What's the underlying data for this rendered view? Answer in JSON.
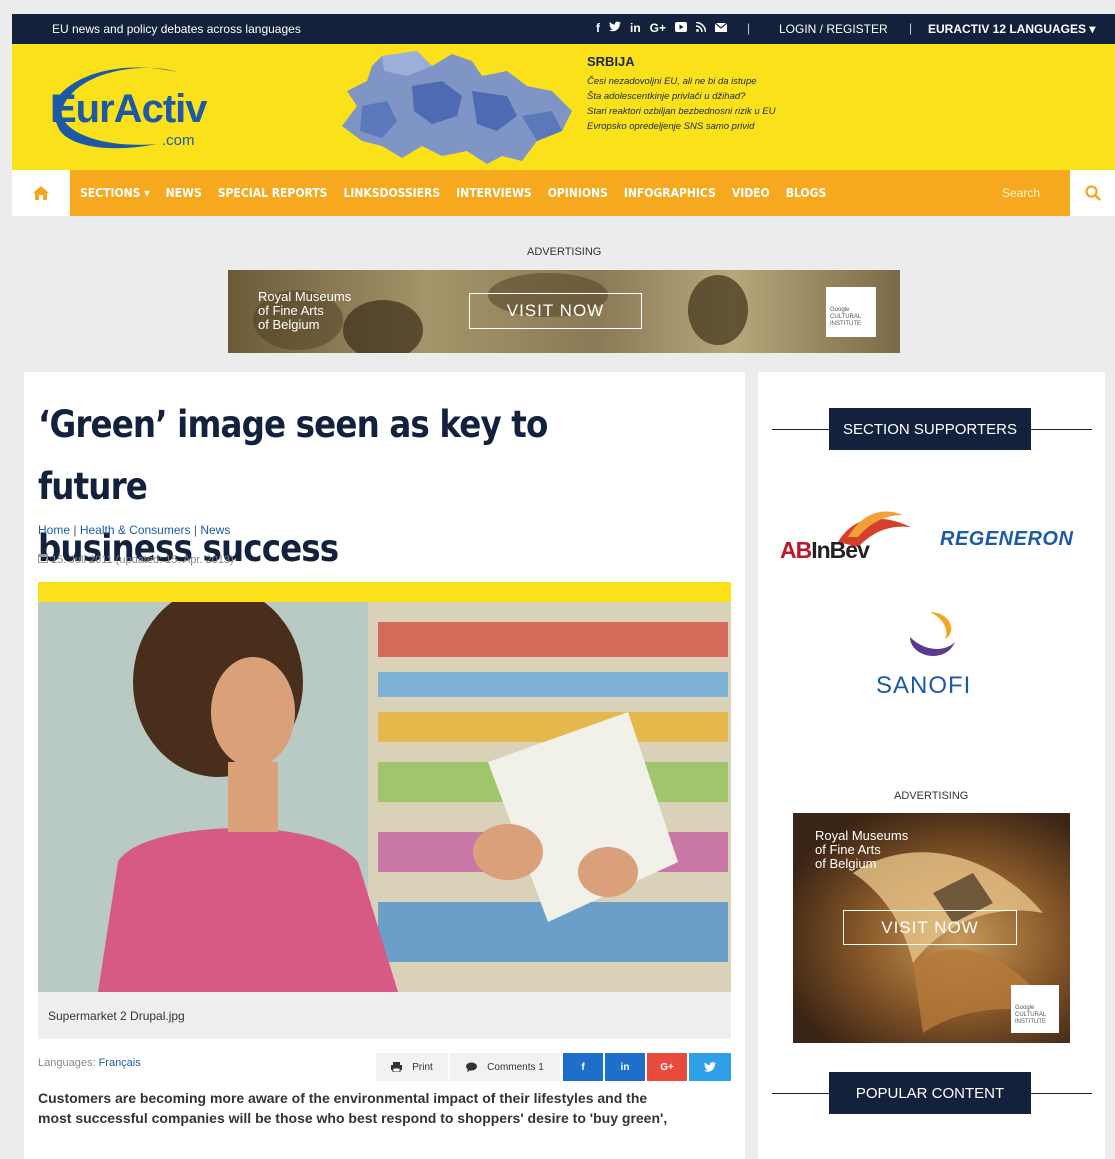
{
  "topbar": {
    "tagline": "EU news and policy debates across languages",
    "social_icons": [
      "facebook-icon",
      "twitter-icon",
      "linkedin-icon",
      "google-plus-icon",
      "youtube-icon",
      "rss-icon",
      "mail-icon"
    ],
    "login": "LOGIN / REGISTER",
    "languages": "EURACTIV 12 LANGUAGES"
  },
  "header": {
    "logo_text": "EurActiv",
    "logo_com": ".com",
    "edition": {
      "title": "SRBIJA",
      "items": [
        "Česi nezadovoljni EU, ali ne bi da istupe",
        "Šta adolescentkinje privlači u džihad?",
        "Stari reaktori ozbiljan bezbednosni rizik u EU",
        "Evropsko opredeljenje SNS samo privid"
      ]
    }
  },
  "nav": {
    "items": [
      "SECTIONS",
      "NEWS",
      "SPECIAL REPORTS",
      "LINKSDOSSIERS",
      "INTERVIEWS",
      "OPINIONS",
      "INFOGRAPHICS",
      "VIDEO",
      "BLOGS"
    ],
    "search_placeholder": "Search"
  },
  "top_ad": {
    "label": "ADVERTISING",
    "museum_line1": "Royal Museums",
    "museum_line2": "of Fine Arts",
    "museum_line3": "of Belgium",
    "cta": "VISIT NOW",
    "partner1": "Google",
    "partner2": "CULTURAL",
    "partner3": "INSTITUTE"
  },
  "article": {
    "title_line1": "‘Green’ image seen as key to future",
    "title_line2": "business success",
    "crumb_home": "Home",
    "crumb_section": "Health & Consumers",
    "crumb_type": "News",
    "date": "15. Juli 2011 (updated: 15. Apr. 2013)",
    "caption": "Supermarket 2 Drupal.jpg",
    "languages_label": "Languages:",
    "languages_value": "Français",
    "print": "Print",
    "comments": "Comments 1",
    "share_fb": "f",
    "share_li": "in",
    "share_gp": "G+",
    "lead_line1": "Customers are becoming more aware of the environmental impact of their lifestyles and the",
    "lead_line2": "most successful companies will be those who best respond to shoppers' desire to 'buy green',"
  },
  "sidebar": {
    "supporters_title": "SECTION SUPPORTERS",
    "sponsor_ab": "AB",
    "sponsor_inbev": "InBev",
    "sponsor_regeneron": "REGENERON",
    "sponsor_sanofi": "SANOFI",
    "ad_label": "ADVERTISING",
    "ad_museum_line1": "Royal Museums",
    "ad_museum_line2": "of Fine Arts",
    "ad_museum_line3": "of Belgium",
    "ad_cta": "VISIT NOW",
    "popular_title": "POPULAR CONTENT"
  },
  "colors": {
    "navy": "#13213d",
    "yellow": "#fbe11a",
    "orange": "#f6a81e",
    "link_blue": "#1d5aa6"
  }
}
